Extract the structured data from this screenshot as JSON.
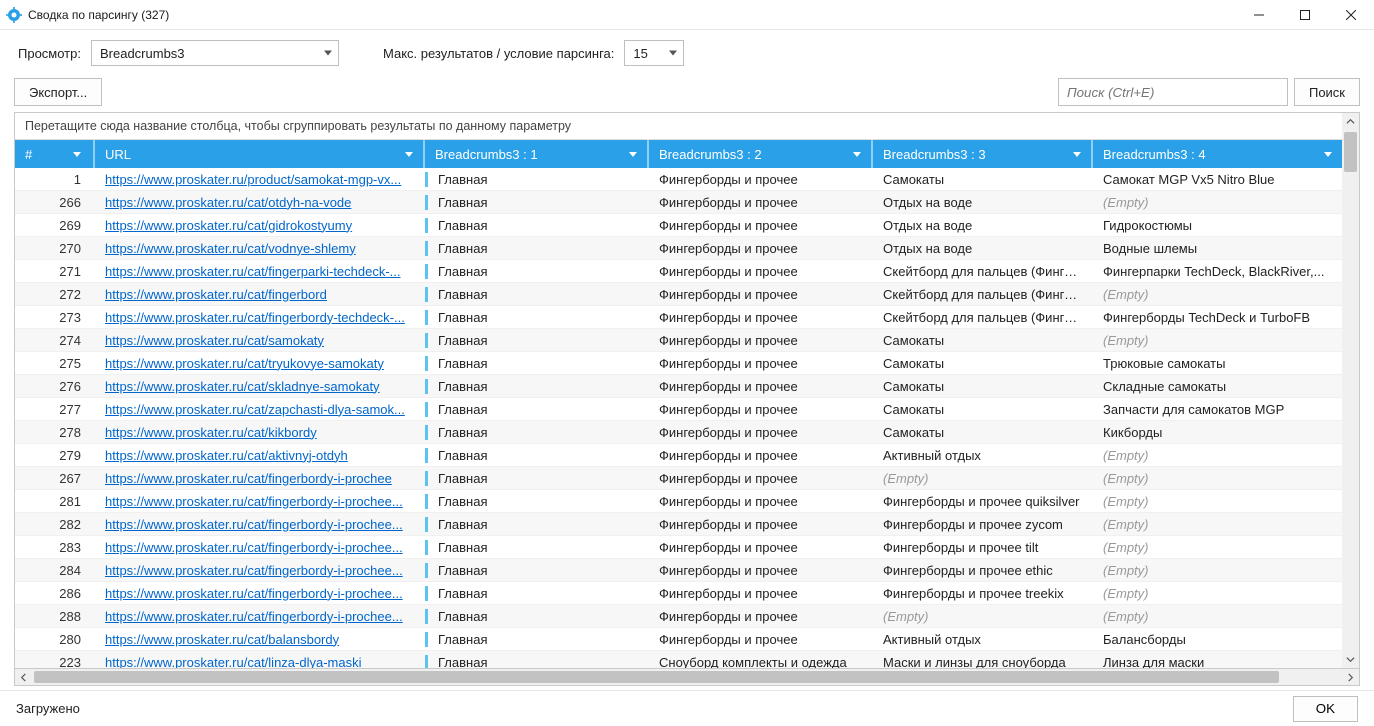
{
  "window": {
    "title": "Сводка по парсингу (327)"
  },
  "toolbar": {
    "view_label": "Просмотр:",
    "view_value": "Breadcrumbs3",
    "max_label": "Макс. результатов / условие парсинга:",
    "max_value": "15"
  },
  "actions": {
    "export": "Экспорт...",
    "search_placeholder": "Поиск (Ctrl+E)",
    "search_btn": "Поиск"
  },
  "grid": {
    "group_hint": "Перетащите сюда название столбца, чтобы сгруппировать результаты по данному параметру",
    "columns": {
      "num": "#",
      "url": "URL",
      "b1": "Breadcrumbs3 : 1",
      "b2": "Breadcrumbs3 : 2",
      "b3": "Breadcrumbs3 : 3",
      "b4": "Breadcrumbs3 : 4"
    },
    "empty_text": "(Empty)",
    "rows": [
      {
        "n": "1",
        "url": "https://www.proskater.ru/product/samokat-mgp-vx...",
        "b1": "Главная",
        "b2": "Фингерборды и прочее",
        "b3": "Самокаты",
        "b4": "Самокат MGP Vx5 Nitro Blue"
      },
      {
        "n": "266",
        "url": "https://www.proskater.ru/cat/otdyh-na-vode",
        "b1": "Главная",
        "b2": "Фингерборды и прочее",
        "b3": "Отдых на воде",
        "b4": ""
      },
      {
        "n": "269",
        "url": "https://www.proskater.ru/cat/gidrokostyumy",
        "b1": "Главная",
        "b2": "Фингерборды и прочее",
        "b3": "Отдых на воде",
        "b4": "Гидрокостюмы"
      },
      {
        "n": "270",
        "url": "https://www.proskater.ru/cat/vodnye-shlemy",
        "b1": "Главная",
        "b2": "Фингерборды и прочее",
        "b3": "Отдых на воде",
        "b4": "Водные шлемы"
      },
      {
        "n": "271",
        "url": "https://www.proskater.ru/cat/fingerparki-techdeck-...",
        "b1": "Главная",
        "b2": "Фингерборды и прочее",
        "b3": "Скейтборд для пальцев (Фингербо...",
        "b4": "Фингерпарки TechDeck, BlackRiver,..."
      },
      {
        "n": "272",
        "url": "https://www.proskater.ru/cat/fingerbord",
        "b1": "Главная",
        "b2": "Фингерборды и прочее",
        "b3": "Скейтборд для пальцев (Фингербо...",
        "b4": ""
      },
      {
        "n": "273",
        "url": "https://www.proskater.ru/cat/fingerbordy-techdeck-...",
        "b1": "Главная",
        "b2": "Фингерборды и прочее",
        "b3": "Скейтборд для пальцев (Фингербо...",
        "b4": "Фингерборды TechDeck и TurboFB"
      },
      {
        "n": "274",
        "url": "https://www.proskater.ru/cat/samokaty",
        "b1": "Главная",
        "b2": "Фингерборды и прочее",
        "b3": "Самокаты",
        "b4": ""
      },
      {
        "n": "275",
        "url": "https://www.proskater.ru/cat/tryukovye-samokaty",
        "b1": "Главная",
        "b2": "Фингерборды и прочее",
        "b3": "Самокаты",
        "b4": "Трюковые самокаты"
      },
      {
        "n": "276",
        "url": "https://www.proskater.ru/cat/skladnye-samokaty",
        "b1": "Главная",
        "b2": "Фингерборды и прочее",
        "b3": "Самокаты",
        "b4": "Складные самокаты"
      },
      {
        "n": "277",
        "url": "https://www.proskater.ru/cat/zapchasti-dlya-samok...",
        "b1": "Главная",
        "b2": "Фингерборды и прочее",
        "b3": "Самокаты",
        "b4": "Запчасти для самокатов MGP"
      },
      {
        "n": "278",
        "url": "https://www.proskater.ru/cat/kikbordy",
        "b1": "Главная",
        "b2": "Фингерборды и прочее",
        "b3": "Самокаты",
        "b4": "Кикборды"
      },
      {
        "n": "279",
        "url": "https://www.proskater.ru/cat/aktivnyj-otdyh",
        "b1": "Главная",
        "b2": "Фингерборды и прочее",
        "b3": "Активный отдых",
        "b4": ""
      },
      {
        "n": "267",
        "url": "https://www.proskater.ru/cat/fingerbordy-i-prochee",
        "b1": "Главная",
        "b2": "Фингерборды и прочее",
        "b3": "",
        "b4": ""
      },
      {
        "n": "281",
        "url": "https://www.proskater.ru/cat/fingerbordy-i-prochee...",
        "b1": "Главная",
        "b2": "Фингерборды и прочее",
        "b3": "Фингерборды и прочее quiksilver",
        "b4": ""
      },
      {
        "n": "282",
        "url": "https://www.proskater.ru/cat/fingerbordy-i-prochee...",
        "b1": "Главная",
        "b2": "Фингерборды и прочее",
        "b3": "Фингерборды и прочее zycom",
        "b4": ""
      },
      {
        "n": "283",
        "url": "https://www.proskater.ru/cat/fingerbordy-i-prochee...",
        "b1": "Главная",
        "b2": "Фингерборды и прочее",
        "b3": "Фингерборды и прочее tilt",
        "b4": ""
      },
      {
        "n": "284",
        "url": "https://www.proskater.ru/cat/fingerbordy-i-prochee...",
        "b1": "Главная",
        "b2": "Фингерборды и прочее",
        "b3": "Фингерборды и прочее ethic",
        "b4": ""
      },
      {
        "n": "286",
        "url": "https://www.proskater.ru/cat/fingerbordy-i-prochee...",
        "b1": "Главная",
        "b2": "Фингерборды и прочее",
        "b3": "Фингерборды и прочее treekix",
        "b4": ""
      },
      {
        "n": "288",
        "url": "https://www.proskater.ru/cat/fingerbordy-i-prochee...",
        "b1": "Главная",
        "b2": "Фингерборды и прочее",
        "b3": "",
        "b4": ""
      },
      {
        "n": "280",
        "url": "https://www.proskater.ru/cat/balansbordy",
        "b1": "Главная",
        "b2": "Фингерборды и прочее",
        "b3": "Активный отдых",
        "b4": "Балансборды"
      },
      {
        "n": "223",
        "url": "https://www.proskater.ru/cat/linza-dlya-maski",
        "b1": "Главная",
        "b2": "Сноуборд комплекты и одежда",
        "b3": "Маски и линзы для сноуборда",
        "b4": "Линза для маски"
      }
    ]
  },
  "status": {
    "loaded": "Загружено",
    "ok": "OK"
  }
}
